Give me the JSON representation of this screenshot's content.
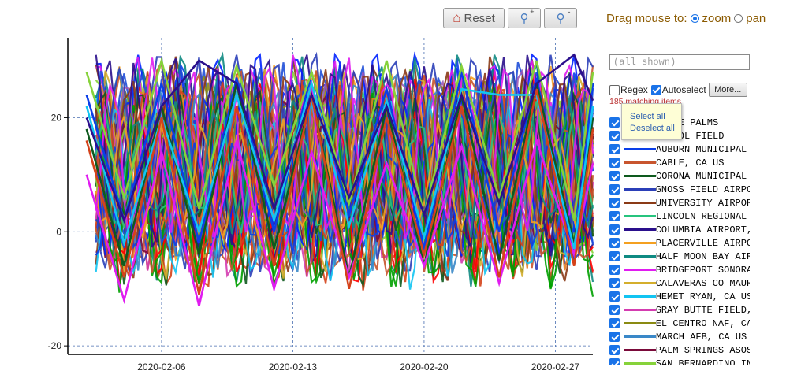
{
  "toolbar": {
    "reset_label": "Reset",
    "zoom_in_label": "+",
    "zoom_out_label": "-",
    "drag_label": "Drag mouse to:",
    "mode_zoom": "zoom",
    "mode_pan": "pan",
    "selected_mode": "zoom"
  },
  "filter": {
    "placeholder": "(all shown)",
    "regex_label": "Regex",
    "regex_checked": false,
    "autoselect_label": "Autoselect",
    "autoselect_checked": true,
    "more_label": "More...",
    "matching_text": "185 matching items"
  },
  "popup": {
    "select_all": "Select all",
    "deselect_all": "Deselect all"
  },
  "legend_items": [
    {
      "label": "YNINE PALMS",
      "color": "#1f4fd8",
      "checked": true
    },
    {
      "label": "E POOL FIELD",
      "color": "#d4421a",
      "checked": true
    },
    {
      "label": "AUBURN MUNICIPAL",
      "color": "#0a3ee8",
      "checked": true
    },
    {
      "label": "CABLE, CA US",
      "color": "#c8552e",
      "checked": true
    },
    {
      "label": "CORONA MUNICIPAL",
      "color": "#0e5a1e",
      "checked": true
    },
    {
      "label": "GNOSS FIELD AIRPO",
      "color": "#2b3fb8",
      "checked": true
    },
    {
      "label": "UNIVERSITY AIRPOR",
      "color": "#8a3a16",
      "checked": true
    },
    {
      "label": "LINCOLN REGIONAL",
      "color": "#26c47e",
      "checked": true
    },
    {
      "label": "COLUMBIA AIRPORT,",
      "color": "#2a0f8c",
      "checked": true
    },
    {
      "label": "PLACERVILLE AIRPO",
      "color": "#f4a020",
      "checked": true
    },
    {
      "label": "HALF MOON BAY AIR",
      "color": "#0f8a82",
      "checked": true
    },
    {
      "label": "BRIDGEPORT SONORA",
      "color": "#e01cf0",
      "checked": true
    },
    {
      "label": "CALAVERAS CO MAUR",
      "color": "#d4ae2c",
      "checked": true
    },
    {
      "label": "HEMET RYAN, CA US",
      "color": "#12c4f2",
      "checked": true
    },
    {
      "label": "GRAY BUTTE FIELD,",
      "color": "#d43cb0",
      "checked": true
    },
    {
      "label": "EL CENTRO NAF, CA",
      "color": "#8a8a12",
      "checked": true
    },
    {
      "label": "MARCH AFB, CA US",
      "color": "#3a88c8",
      "checked": true
    },
    {
      "label": "PALM SPRINGS ASOS",
      "color": "#7a0a3a",
      "checked": true
    },
    {
      "label": "SAN BERNARDINO IN",
      "color": "#86d23a",
      "checked": true
    }
  ],
  "chart_data": {
    "type": "line",
    "x_start": "2020-02-01",
    "x_end": "2020-02-29",
    "x_ticks": [
      "2020-02-06",
      "2020-02-13",
      "2020-02-20",
      "2020-02-27"
    ],
    "y_ticks": [
      20,
      0,
      -20
    ],
    "ylim": [
      -21.5,
      34
    ],
    "grid": "dashed",
    "series_count": 185,
    "series": [
      {
        "name": "AUBURN MUNICIPAL",
        "color": "#0a3ee8",
        "x": [
          "2020-02-02",
          "2020-02-04",
          "2020-02-06",
          "2020-02-08",
          "2020-02-10",
          "2020-02-12",
          "2020-02-14",
          "2020-02-16",
          "2020-02-18",
          "2020-02-20",
          "2020-02-22",
          "2020-02-24",
          "2020-02-26",
          "2020-02-28",
          "2020-02-29"
        ],
        "y": [
          24,
          2,
          26,
          -2,
          27,
          0,
          28,
          3,
          25,
          -3,
          28,
          0,
          27,
          -5,
          26
        ]
      },
      {
        "name": "CORONA MUNICIPAL",
        "color": "#0e5a1e",
        "x": [
          "2020-02-02",
          "2020-02-04",
          "2020-02-06",
          "2020-02-08",
          "2020-02-10",
          "2020-02-12",
          "2020-02-14",
          "2020-02-16",
          "2020-02-18",
          "2020-02-20",
          "2020-02-22",
          "2020-02-24",
          "2020-02-26",
          "2020-02-28",
          "2020-02-29"
        ],
        "y": [
          18,
          -6,
          22,
          -4,
          26,
          -3,
          24,
          -8,
          22,
          -6,
          24,
          -5,
          26,
          -2,
          20
        ]
      },
      {
        "name": "BRIDGEPORT SONORA",
        "color": "#e01cf0",
        "x": [
          "2020-02-02",
          "2020-02-04",
          "2020-02-06",
          "2020-02-08",
          "2020-02-10",
          "2020-02-12",
          "2020-02-14",
          "2020-02-16",
          "2020-02-18",
          "2020-02-20",
          "2020-02-22",
          "2020-02-24",
          "2020-02-26",
          "2020-02-28",
          "2020-02-29"
        ],
        "y": [
          10,
          -12,
          14,
          -13,
          16,
          -10,
          14,
          -8,
          12,
          -6,
          15,
          -9,
          16,
          -4,
          12
        ]
      },
      {
        "name": "HEMET RYAN, CA US",
        "color": "#12c4f2",
        "x": [
          "2020-02-02",
          "2020-02-04",
          "2020-02-06",
          "2020-02-08",
          "2020-02-10",
          "2020-02-12",
          "2020-02-14",
          "2020-02-16",
          "2020-02-18",
          "2020-02-20",
          "2020-02-22",
          "2020-02-24",
          "2020-02-26",
          "2020-02-28",
          "2020-02-29"
        ],
        "y": [
          22,
          -2,
          20,
          0,
          24,
          2,
          26,
          1,
          23,
          -1,
          25,
          24,
          24,
          -3,
          22
        ]
      },
      {
        "name": "SAN BERNARDINO IN",
        "color": "#86d23a",
        "x": [
          "2020-02-02",
          "2020-02-04",
          "2020-02-06",
          "2020-02-08",
          "2020-02-10",
          "2020-02-12",
          "2020-02-14",
          "2020-02-16",
          "2020-02-18",
          "2020-02-20",
          "2020-02-22",
          "2020-02-24",
          "2020-02-26",
          "2020-02-28",
          "2020-02-29"
        ],
        "y": [
          28,
          6,
          30,
          4,
          29,
          8,
          28,
          5,
          30,
          3,
          29,
          6,
          30,
          2,
          28
        ]
      },
      {
        "name": "E POOL FIELD",
        "color": "#d4421a",
        "x": [
          "2020-02-02",
          "2020-02-04",
          "2020-02-06",
          "2020-02-08",
          "2020-02-10",
          "2020-02-12",
          "2020-02-14",
          "2020-02-16",
          "2020-02-18",
          "2020-02-20",
          "2020-02-22",
          "2020-02-24",
          "2020-02-26",
          "2020-02-28",
          "2020-02-29"
        ],
        "y": [
          16,
          -8,
          20,
          -11,
          22,
          -6,
          24,
          -10,
          20,
          -4,
          22,
          -8,
          25,
          -6,
          18
        ]
      },
      {
        "name": "COLUMBIA AIRPORT,",
        "color": "#2a0f8c",
        "x": [
          "2020-02-02",
          "2020-02-04",
          "2020-02-06",
          "2020-02-08",
          "2020-02-10",
          "2020-02-12",
          "2020-02-14",
          "2020-02-16",
          "2020-02-18",
          "2020-02-20",
          "2020-02-22",
          "2020-02-24",
          "2020-02-26",
          "2020-02-28",
          "2020-02-29"
        ],
        "y": [
          20,
          2,
          22,
          30,
          26,
          4,
          24,
          6,
          22,
          3,
          24,
          5,
          26,
          31,
          23
        ]
      }
    ]
  }
}
